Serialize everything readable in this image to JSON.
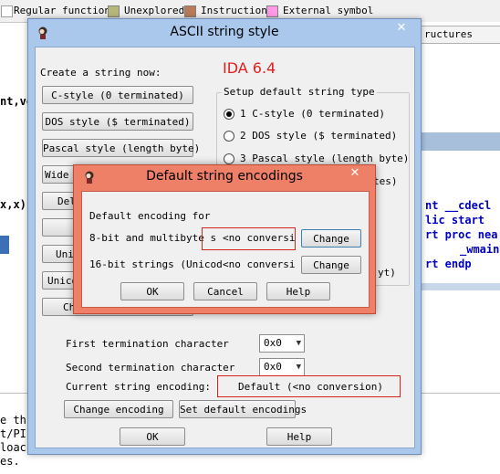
{
  "legend": {
    "items": [
      {
        "label": "Regular function",
        "color": "#ffffff"
      },
      {
        "label": "Unexplored",
        "color": "#b7b77a"
      },
      {
        "label": "Instruction",
        "color": "#b97a57"
      },
      {
        "label": "External symbol",
        "color": "#ff9ae5"
      }
    ]
  },
  "background": {
    "tab_label": "ructures",
    "left_fragments": [
      "nt,vo",
      "x,x)"
    ],
    "asm_lines": [
      "nt __cdecl",
      "lic start",
      "rt proc nea",
      "_wmain",
      "rt endp"
    ],
    "bottom_lines": [
      "e th",
      "t/PI",
      "loac",
      "es."
    ]
  },
  "dialog": {
    "title": "ASCII string style",
    "close_label": "✕",
    "ida_version": "IDA 6.4",
    "create_label": "Create a string now:",
    "create_buttons": [
      "C-style (0 terminated)",
      "DOS style ($ terminated)",
      "Pascal style (length byte)",
      "Wide p",
      "Del",
      "",
      "Unic",
      "Unico",
      "Ch"
    ],
    "setup_group_label": "Setup default string type",
    "radio_options": [
      {
        "label": "1 C-style (0 terminated)",
        "checked": true
      },
      {
        "label": "2 DOS style ($ terminated)",
        "checked": false
      },
      {
        "label": "3 Pascal style (length byte)",
        "checked": false
      },
      {
        "label": "tes)",
        "checked": false
      },
      {
        "label": "yt)",
        "checked": false
      }
    ],
    "first_term_label": "First termination character",
    "first_term_value": "0x0",
    "second_term_label": "Second termination character",
    "second_term_value": "0x0",
    "encoding_label": "Current string encoding:",
    "encoding_value": "Default (<no conversion)",
    "change_encoding_label": "Change encoding",
    "set_default_label": "Set default encodings",
    "ok_label": "OK",
    "help_label": "Help"
  },
  "popup": {
    "title": "Default string encodings",
    "close_label": "✕",
    "default_for_label": "Default encoding for",
    "eight_bit_label": "8-bit and multibyte s",
    "eight_bit_value": "<no conversi",
    "sixteen_bit_label": "16-bit strings (Unicod",
    "sixteen_bit_value": "<no conversi",
    "change_label": "Change",
    "ok_label": "OK",
    "cancel_label": "Cancel",
    "help_label": "Help"
  },
  "colors": {
    "title_bar": "#a9c8ec",
    "popup_title_bar": "#ee8068",
    "highlight_red": "#d9241a",
    "ida_red": "#e02020"
  }
}
